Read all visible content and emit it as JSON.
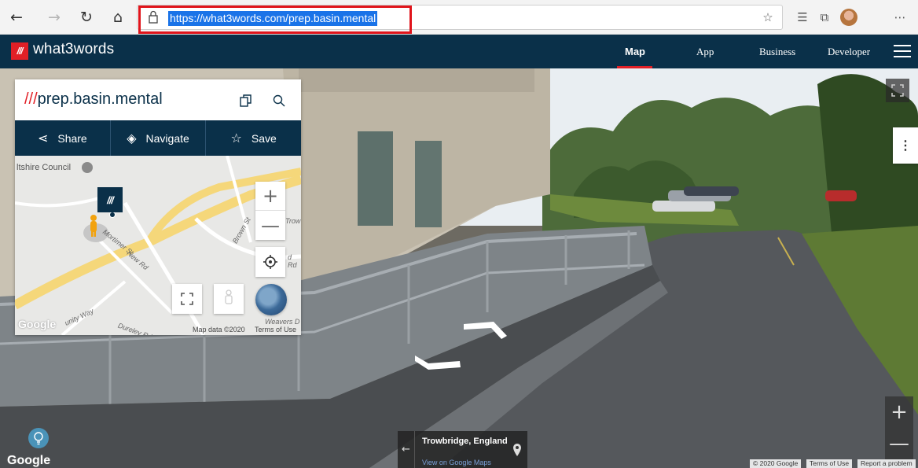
{
  "browser": {
    "url": "https://what3words.com/prep.basin.mental",
    "icons": [
      "back-icon",
      "forward-icon",
      "refresh-icon",
      "home-icon",
      "lock-icon",
      "favorite-star-icon",
      "favorites-list-icon",
      "collections-icon",
      "profile-avatar",
      "more-icon"
    ],
    "highlight_color": "#e0141b"
  },
  "header": {
    "logo_mark": "///",
    "logo_text": "what3words",
    "nav": [
      "Map",
      "App",
      "Business",
      "Developer"
    ],
    "active_nav": "Map",
    "brand_color": "#0a3049",
    "accent_color": "#e11f26"
  },
  "panel": {
    "slashes": "///",
    "address": "prep.basin.mental",
    "actions": {
      "share": "Share",
      "navigate": "Navigate",
      "save": "Save"
    },
    "map": {
      "place_label": "ltshire Council",
      "road_labels": [
        "Mortimer St",
        "New Rd",
        "Brown St",
        "Trow",
        "d Rd",
        "unity Way",
        "Dureley Rd",
        "Weavers D"
      ],
      "marker": "///",
      "google_logo": "Google",
      "footer_data": "Map data ©2020",
      "footer_terms": "Terms of Use"
    }
  },
  "streetview": {
    "location_title": "Trowbridge, England",
    "location_link": "View on Google Maps",
    "side_button": "⋮",
    "zoom_in": "+",
    "zoom_out": "—",
    "google_logo": "Google",
    "footer": [
      "© 2020 Google",
      "Terms of Use",
      "Report a problem"
    ]
  }
}
